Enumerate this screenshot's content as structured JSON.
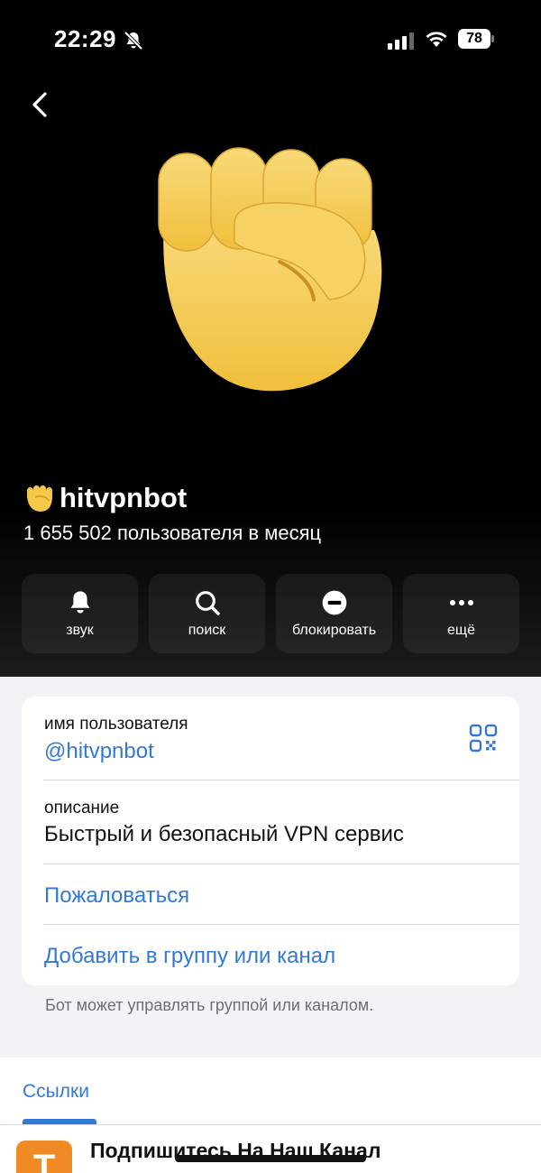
{
  "status_bar": {
    "time": "22:29",
    "battery": "78"
  },
  "profile": {
    "name": "hitvpnbot",
    "subscribers": "1 655 502 пользователя в месяц"
  },
  "actions": [
    {
      "id": "sound",
      "label": "звук",
      "icon": "bell-icon"
    },
    {
      "id": "search",
      "label": "поиск",
      "icon": "search-icon"
    },
    {
      "id": "block",
      "label": "блокировать",
      "icon": "block-icon"
    },
    {
      "id": "more",
      "label": "ещё",
      "icon": "more-icon"
    }
  ],
  "info": {
    "username_caption": "имя пользователя",
    "username": "@hitvpnbot",
    "description_caption": "описание",
    "description": "Быстрый и безопасный VPN сервис",
    "report": "Пожаловаться",
    "add_to_group": "Добавить в группу или канал"
  },
  "hint": "Бот может управлять группой или каналом.",
  "links": {
    "tab": "Ссылки",
    "item_thumb": "T",
    "item_title": "Подпишитесь На Наш Канал"
  },
  "colors": {
    "accent": "#3478d6",
    "thumb": "#f08a24",
    "fist": "#f5c84a"
  }
}
